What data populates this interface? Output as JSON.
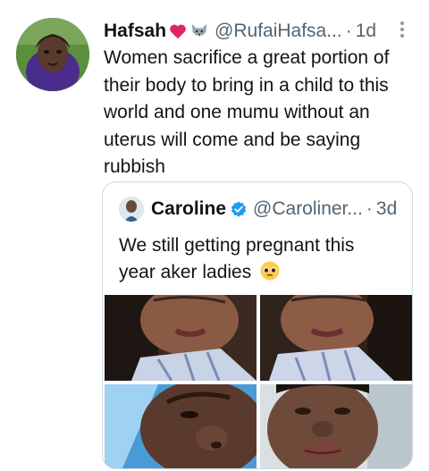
{
  "tweet": {
    "display_name": "Hafsah",
    "handle": "@RufaiHafsa...",
    "separator": "·",
    "time": "1d",
    "body": "Women sacrifice a great portion of their body to bring in a child to this world and one mumu without an uterus will come and be saying rubbish",
    "name_emojis": [
      "red-heart",
      "wolf-face"
    ]
  },
  "quote": {
    "display_name": "Caroline",
    "handle": "@Caroliner...",
    "separator": "·",
    "time": "3d",
    "text": "We still getting pregnant this year aker ladies",
    "text_emoji": "pleading-face",
    "verified": true,
    "media_count": 4
  },
  "colors": {
    "text_primary": "#0f1419",
    "text_secondary": "#536471",
    "border": "#cfd9de",
    "verified": "#1d9bf0",
    "heart": "#e0245e"
  }
}
